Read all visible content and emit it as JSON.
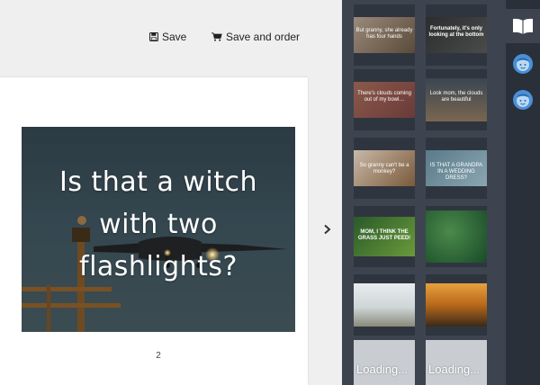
{
  "toolbar": {
    "save_label": "Save",
    "save_and_order_label": "Save and order"
  },
  "card": {
    "lines": [
      "Is that a witch",
      "with two",
      "flashlights?"
    ]
  },
  "page_number": "2",
  "gallery": {
    "thumbs": [
      {
        "caption": "But granny, she already has four hands"
      },
      {
        "caption": "Fortunately, it's only looking at the bottom"
      },
      {
        "caption": "There's clouds coming out of my bowl…"
      },
      {
        "caption": "Look mom, the clouds are beautiful"
      },
      {
        "caption": "So granny can't be a monkey?"
      },
      {
        "caption": "IS THAT A GRANDPA IN A WEDDING DRESS?"
      },
      {
        "caption": "MOM, I THINK THE GRASS JUST PEED!"
      },
      {
        "caption": ""
      },
      {
        "caption": ""
      },
      {
        "caption": ""
      },
      {
        "caption": "Loading..."
      },
      {
        "caption": "Loading..."
      }
    ]
  },
  "colors": {
    "gallery_bg": "#3d4450",
    "nav_bg": "#2a3039",
    "icon_blue": "#4a90d9"
  }
}
